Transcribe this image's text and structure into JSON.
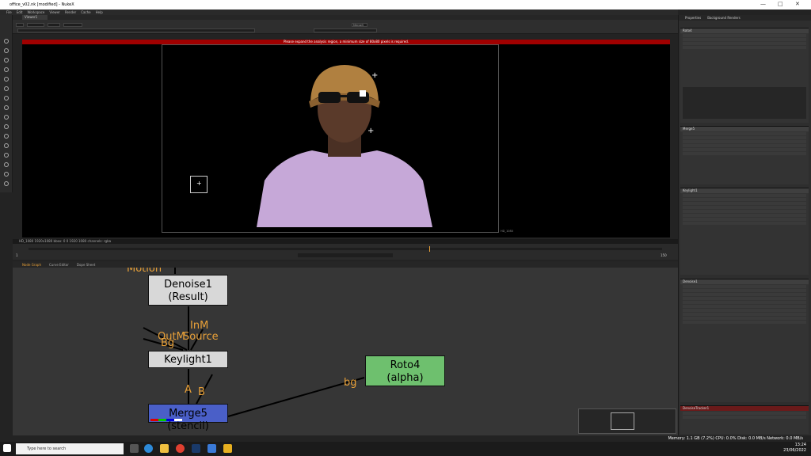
{
  "window": {
    "title": "office_v02.nk [modified] - NukeX"
  },
  "menu": [
    "File",
    "Edit",
    "Workspace",
    "Viewer",
    "Render",
    "Cache",
    "Help"
  ],
  "viewer": {
    "tab": "Viewer1",
    "merge_field": "Merge5",
    "warning": "Please expand the analysis region, a minimum size of 80x80 pixels is required.",
    "info": "HD_1080 1920x1080  bbox: 0 0 1920 1080 channels: rgba",
    "frame_label": "HD_1080"
  },
  "timeline": {
    "start": "1",
    "end": "150",
    "current": "100"
  },
  "node_tabs": [
    {
      "label": "Node Graph",
      "active": true
    },
    {
      "label": "Curve Editor",
      "active": false
    },
    {
      "label": "Dope Sheet",
      "active": false
    }
  ],
  "nodes": {
    "top_label": "Motion",
    "denoise": {
      "line1": "Denoise1",
      "line2": "(Result)"
    },
    "inm_label": "InM",
    "source_label": "Source",
    "outm_label": "OutM",
    "bg_label_1": "Bg",
    "keylight": {
      "line1": "Keylight1"
    },
    "a_label": "A",
    "b_label": "B",
    "merge": {
      "line1": "Merge5 (stencil)"
    },
    "bg_label_2": "bg",
    "roto": {
      "line1": "Roto4",
      "line2": "(alpha)"
    }
  },
  "status": "Memory: 1.1 GB (7.2%) CPU: 0.0% Disk: 0.0 MB/s Network: 0.0 MB/s",
  "properties": {
    "tabs": [
      "Properties",
      "Background Renders"
    ],
    "sections": [
      "Roto4",
      "Merge5",
      "Keylight1",
      "Denoise1",
      "DenoiseTracker1"
    ]
  },
  "taskbar": {
    "search_placeholder": "Type here to search",
    "time": "13:24",
    "date": "23/06/2022"
  },
  "colors": {
    "denoise_node": "#d8d8d8",
    "keylight_node": "#d8d8d8",
    "merge_node": "#4a5fc8",
    "roto_node": "#6ec06e",
    "label": "#e8a038",
    "warning": "#a00000"
  }
}
